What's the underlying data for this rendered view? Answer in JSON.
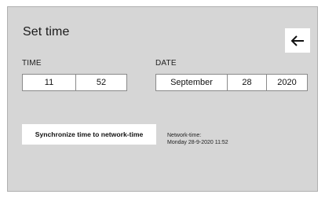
{
  "screen": {
    "title": "Set time",
    "back_icon": "arrow-left-icon"
  },
  "time": {
    "label": "TIME",
    "hour": "11",
    "minute": "52"
  },
  "date": {
    "label": "DATE",
    "month": "September",
    "day": "28",
    "year": "2020"
  },
  "sync": {
    "button_label": "Synchronize time to network-time",
    "network_time_label": "Network-time:",
    "network_time_value": "Monday 28-9-2020 11:52"
  },
  "colors": {
    "panel_background": "#d6d6d6",
    "field_background": "#ffffff",
    "border": "#8a8a8a"
  }
}
